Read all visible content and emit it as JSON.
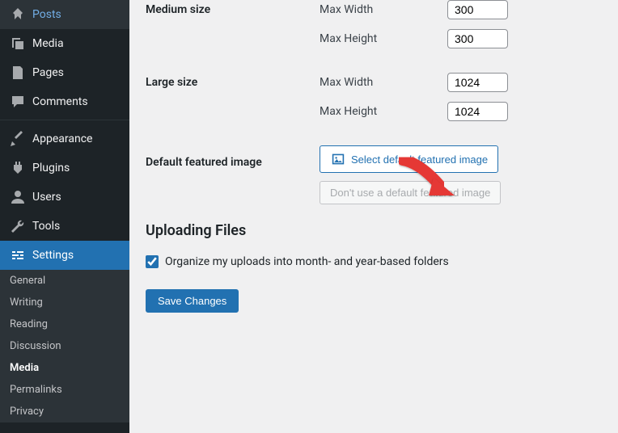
{
  "sidebar": {
    "items": [
      {
        "label": "Posts",
        "icon": "pin"
      },
      {
        "label": "Media",
        "icon": "media"
      },
      {
        "label": "Pages",
        "icon": "pages"
      },
      {
        "label": "Comments",
        "icon": "comments"
      },
      {
        "label": "Appearance",
        "icon": "appearance"
      },
      {
        "label": "Plugins",
        "icon": "plugins"
      },
      {
        "label": "Users",
        "icon": "users"
      },
      {
        "label": "Tools",
        "icon": "tools"
      },
      {
        "label": "Settings",
        "icon": "settings"
      }
    ],
    "submenu": [
      {
        "label": "General"
      },
      {
        "label": "Writing"
      },
      {
        "label": "Reading"
      },
      {
        "label": "Discussion"
      },
      {
        "label": "Media",
        "current": true
      },
      {
        "label": "Permalinks"
      },
      {
        "label": "Privacy"
      }
    ]
  },
  "form": {
    "medium": {
      "label": "Medium size",
      "maxw_label": "Max Width",
      "maxw": "300",
      "maxh_label": "Max Height",
      "maxh": "300"
    },
    "large": {
      "label": "Large size",
      "maxw_label": "Max Width",
      "maxw": "1024",
      "maxh_label": "Max Height",
      "maxh": "1024"
    },
    "dfi": {
      "label": "Default featured image",
      "select_btn": "Select default featured image",
      "remove_btn": "Don't use a default featured image"
    },
    "uploading": {
      "heading": "Uploading Files",
      "organize": "Organize my uploads into month- and year-based folders"
    },
    "save": "Save Changes"
  }
}
